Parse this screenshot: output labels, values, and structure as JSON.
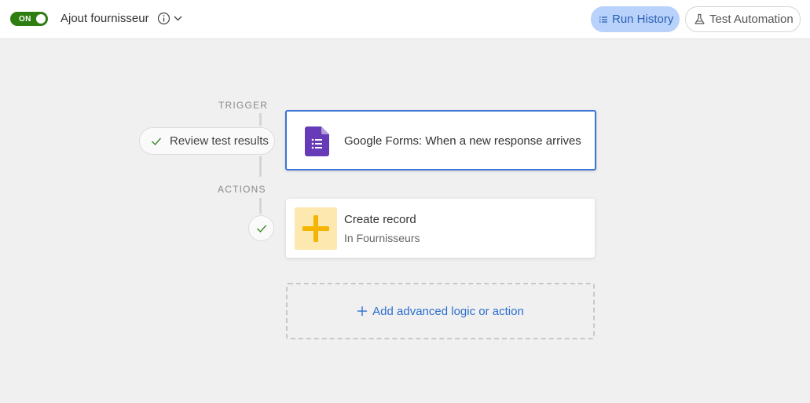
{
  "header": {
    "toggle_label": "ON",
    "automation_title": "Ajout fournisseur",
    "run_history_label": "Run History",
    "test_automation_label": "Test Automation"
  },
  "flow": {
    "trigger_label": "TRIGGER",
    "actions_label": "ACTIONS",
    "review_label": "Review test results",
    "trigger_text": "Google Forms: When a new response arrives",
    "action_title": "Create record",
    "action_subtitle": "In Fournisseurs",
    "add_label": "Add advanced logic or action"
  },
  "colors": {
    "toggle_on": "#2d7d0f",
    "accent_blue": "#3b76d6",
    "forms_purple": "#673ab7",
    "action_yellow": "#f4b400"
  },
  "icons": [
    "info-icon",
    "chevron-down-icon",
    "list-icon",
    "flask-icon",
    "check-icon",
    "google-forms-icon",
    "plus-icon"
  ]
}
